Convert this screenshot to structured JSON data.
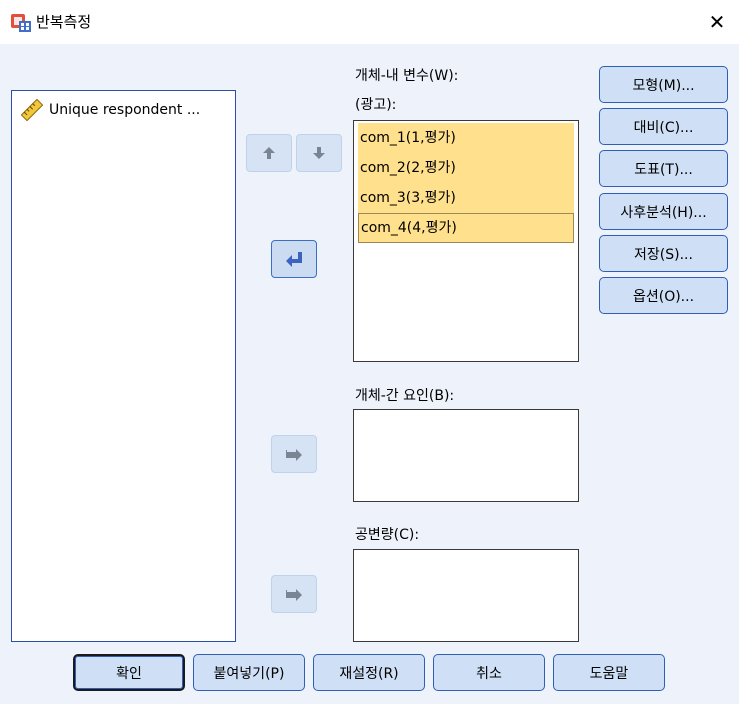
{
  "window": {
    "title": "반복측정",
    "close_glyph": "✕"
  },
  "source": {
    "items": [
      {
        "label": "Unique respondent ...",
        "icon": "scale-ruler-icon"
      }
    ]
  },
  "within": {
    "label": "개체-내 변수(W):",
    "factor": "(광고):",
    "variables": [
      "com_1(1,평가)",
      "com_2(2,평가)",
      "com_3(3,평가)",
      "com_4(4,평가)"
    ]
  },
  "between": {
    "label": "개체-간 요인(B):"
  },
  "covariates": {
    "label": "공변량(C):"
  },
  "side_buttons": {
    "model": "모형(M)...",
    "contrast": "대비(C)...",
    "plots": "도표(T)...",
    "posthoc": "사후분석(H)...",
    "save": "저장(S)...",
    "options": "옵션(O)..."
  },
  "bottom_buttons": {
    "ok": "확인",
    "paste": "붙여넣기(P)",
    "reset": "재설정(R)",
    "cancel": "취소",
    "help": "도움말"
  },
  "colors": {
    "dialog_bg": "#eef3fb",
    "button_bg": "#cfe0f6",
    "button_border": "#2f5fb4",
    "selected_row": "#ffe08c",
    "arrow_blue": "#3d63c0",
    "arrow_gray": "#7a8594"
  }
}
